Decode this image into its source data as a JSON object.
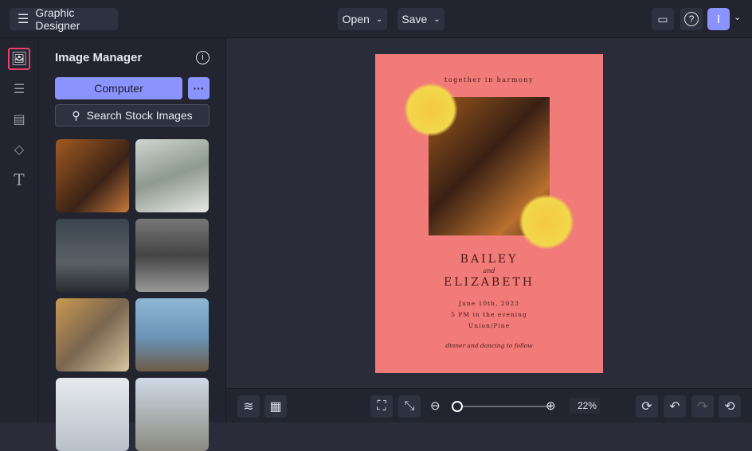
{
  "header": {
    "app_title": "Graphic Designer",
    "open_label": "Open",
    "save_label": "Save",
    "avatar_initial": "I"
  },
  "panel": {
    "title": "Image Manager",
    "computer_label": "Computer",
    "more_label": "···",
    "search_label": "Search Stock Images"
  },
  "card": {
    "tagline": "together in harmony",
    "name1": "BAILEY",
    "and": "and",
    "name2": "ELIZABETH",
    "date": "June 10th, 2023",
    "time": "5 PM in the evening",
    "venue": "Union/Pine",
    "footer": "dinner and dancing to follow"
  },
  "zoom": {
    "value": "22%",
    "fraction": 0.05
  },
  "colors": {
    "accent": "#8b93ff",
    "card": "#f07b78",
    "highlight": "#e8416e"
  }
}
